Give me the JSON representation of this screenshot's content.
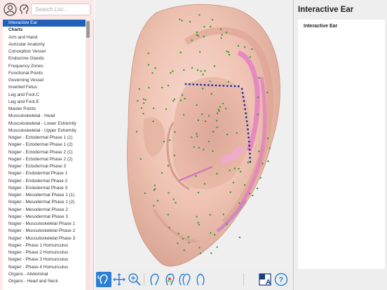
{
  "search": {
    "placeholder": "Search List..."
  },
  "list": {
    "items": [
      "Interactive Ear",
      "Charts",
      "Arm and Hand",
      "Auricular Anatomy",
      "Conception Vessel",
      "Endocrine Glands",
      "Frequency Zones",
      "Functional Points",
      "Governing Vessel",
      "Inverted Fetus",
      "Leg and Foot.C",
      "Leg and Foot.E",
      "Master Points",
      "Musculoskeletal - Head",
      "Musculoskeletal - Lower Extremity",
      "Musculoskeletal - Upper Extremity",
      "Nogier - Ectodermal Phase 1 (1)",
      "Nogier - Ectodermal Phase 1 (2)",
      "Nogier - Ectodermal Phase 2 (1)",
      "Nogier - Ectodermal Phase 2 (2)",
      "Nogier - Ectodermal Phase 3",
      "Nogier - Endodermal Phase 1",
      "Nogier - Endodermal Phase 2",
      "Nogier - Endodermal Phase 3",
      "Nogier - Mesodermal Phase 1 (1)",
      "Nogier - Mesodermal Phase 1 (2)",
      "Nogier - Mesodermal Phase 2",
      "Nogier - Mesodermal Phase 3",
      "Nogier - Musculoskeletal Phase 1",
      "Nogier - Musculoskeletal Phase 2",
      "Nogier - Musculoskeletal Phase 3",
      "Nogier - Phase 1 Homunculus",
      "Nogier - Phase 2 Homunculus",
      "Nogier - Phase 3 Homunculus",
      "Nogier - Phase 4 Homunculus",
      "Organs - Abdominal",
      "Organs - Head and Neck"
    ],
    "selected_index": 0,
    "section_index": 1
  },
  "right_panel": {
    "title": "Interactive Ear",
    "subtitle": "Interactive Ear"
  },
  "toolbar": {
    "buttons": [
      "ear-rotate-icon",
      "move-icon",
      "zoom-in-icon",
      "ear-outline-icon",
      "ear-color-icon",
      "ear-pair-icon",
      "ear-flip-icon",
      "label-toggle-icon",
      "help-icon"
    ]
  },
  "colors": {
    "accent": "#2161ba",
    "sidebar_bg": "#fde8e8",
    "point_green": "#2e9e2e",
    "point_blue": "#1f2fb0",
    "zone_pink": "#e57fc4"
  }
}
